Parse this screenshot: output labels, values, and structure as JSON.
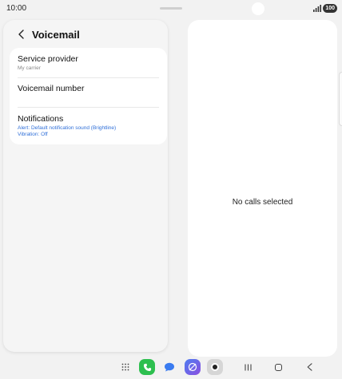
{
  "status_bar": {
    "time": "10:00",
    "battery": "100"
  },
  "header": {
    "title": "Voicemail"
  },
  "settings": [
    {
      "title": "Service provider",
      "subtitle": "My carrier"
    },
    {
      "title": "Voicemail number"
    },
    {
      "title": "Notifications",
      "details": [
        "Alert: Default notification sound (Brightline)",
        "Vibration: Off"
      ]
    }
  ],
  "detail_pane": {
    "empty_text": "No calls selected"
  },
  "taskbar": {
    "icons": [
      "apps-grid-icon",
      "phone-app-icon",
      "messages-app-icon",
      "internet-app-icon",
      "camera-app-icon",
      "recent-apps-icon",
      "home-icon",
      "back-icon"
    ]
  },
  "colors": {
    "accent_blue": "#2f6fd8",
    "phone_green": "#2dbf4f",
    "background": "#f2f2f2"
  }
}
